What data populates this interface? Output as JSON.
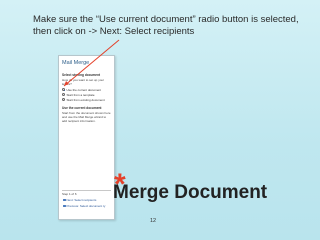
{
  "slide": {
    "instruction": "Make sure the “Use current document” radio button is selected, then click on -> Next: Select recipients",
    "heading": "Merge Document",
    "asterisk": "*",
    "page_number": "12"
  },
  "pane": {
    "title": "Mail Merge",
    "section_select": "Select starting document",
    "question": "How do you want to set up your letters?",
    "options": [
      {
        "label": "Use the current document",
        "selected": true
      },
      {
        "label": "Start from a template",
        "selected": false
      },
      {
        "label": "Start from existing document",
        "selected": false
      }
    ],
    "section_use": "Use the current document",
    "use_text": "Start from the document shown here and use the Mail Merge wizard to add recipient information.",
    "step": "Step 1 of 6",
    "next_link": "Next: Select recipients",
    "prev_link": "Previous: Select document ty"
  },
  "colors": {
    "arrow": "#e4412a",
    "accent": "#2b5797"
  },
  "icons": [
    "next-arrow-icon",
    "previous-arrow-icon"
  ]
}
